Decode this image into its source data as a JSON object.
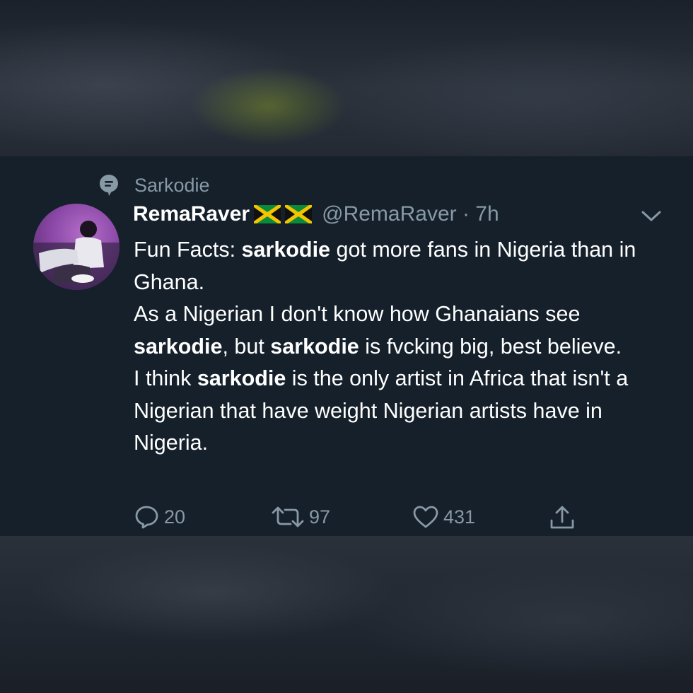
{
  "topic": {
    "label": "Sarkodie",
    "icon": "topic-pin-icon"
  },
  "tweet": {
    "display_name": "RemaRaver",
    "flags": [
      "jamaica-flag-icon",
      "jamaica-flag-icon"
    ],
    "handle_time": "@RemaRaver · 7h",
    "body": [
      [
        {
          "text": "Fun Facts: ",
          "bold": false
        },
        {
          "text": "sarkodie",
          "bold": true
        },
        {
          "text": " got more fans in Nigeria than in Ghana.",
          "bold": false
        }
      ],
      [
        {
          "text": "As a Nigerian I don't know how Ghanaians see ",
          "bold": false
        },
        {
          "text": "sarkodie",
          "bold": true
        },
        {
          "text": ", but ",
          "bold": false
        },
        {
          "text": "sarkodie",
          "bold": true
        },
        {
          "text": " is fvcking big, best believe.",
          "bold": false
        }
      ],
      [
        {
          "text": "I think ",
          "bold": false
        },
        {
          "text": "sarkodie",
          "bold": true
        },
        {
          "text": " is the only artist in Africa that isn't a Nigerian that have weight Nigerian artists have in Nigeria.",
          "bold": false
        }
      ]
    ],
    "replies": "20",
    "retweets": "97",
    "likes": "431"
  },
  "colors": {
    "background": "#15202b",
    "secondary_text": "#8899a6",
    "primary_text": "#ffffff"
  }
}
